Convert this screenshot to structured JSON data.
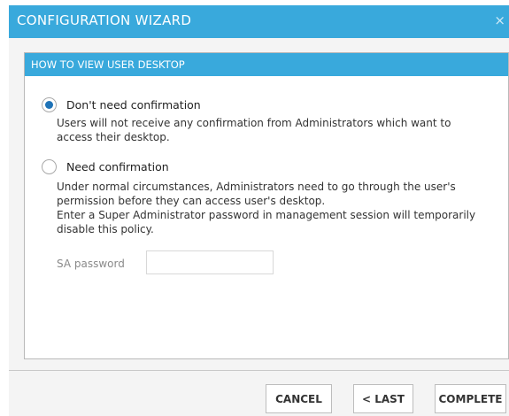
{
  "window": {
    "title": "CONFIGURATION WIZARD",
    "close_glyph": "×"
  },
  "panel": {
    "title": "HOW TO VIEW USER DESKTOP",
    "options": [
      {
        "label": "Don't need confirmation",
        "selected": true,
        "description": [
          "Users will not receive any confirmation from Administrators which want to",
          "access their desktop."
        ]
      },
      {
        "label": "Need confirmation",
        "selected": false,
        "description": [
          "Under normal circumstances, Administrators need to go through the user's",
          "permission before they can access user's desktop.",
          "Enter a Super Administrator password in management session will temporarily",
          "disable this policy."
        ]
      }
    ],
    "sa_password": {
      "label": "SA password",
      "value": ""
    }
  },
  "buttons": {
    "cancel": "CANCEL",
    "last": "< LAST",
    "complete": "COMPLETE"
  },
  "colors": {
    "accent": "#39a9dc",
    "radio_selected": "#1f73b7"
  }
}
